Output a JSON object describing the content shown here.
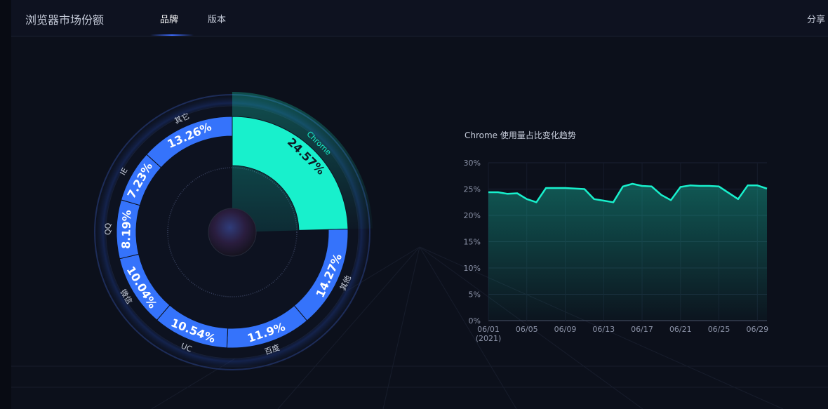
{
  "header": {
    "title": "浏览器市场份额",
    "tabs": [
      {
        "label": "品牌",
        "active": true
      },
      {
        "label": "版本",
        "active": false
      }
    ],
    "share_label": "分享"
  },
  "colors": {
    "accent": "#18f0cc",
    "segment": "#3573fb",
    "background": "#0c101b"
  },
  "chart_data": [
    {
      "type": "pie",
      "categories": [
        "Chrome",
        "其他",
        "百度",
        "UC",
        "微信",
        "QQ",
        "IE",
        "其它"
      ],
      "values": [
        24.57,
        14.27,
        11.9,
        10.54,
        10.04,
        8.19,
        7.23,
        13.26
      ],
      "labels": [
        "24.57%",
        "14.27%",
        "11.9%",
        "10.54%",
        "10.04%",
        "8.19%",
        "7.23%",
        "13.26%"
      ],
      "highlighted": "Chrome"
    },
    {
      "type": "area",
      "title": "Chrome 使用量占比变化趋势",
      "x_ticks": [
        "06/01",
        "06/05",
        "06/09",
        "06/13",
        "06/17",
        "06/21",
        "06/25",
        "06/29"
      ],
      "x_sub_label": "(2021)",
      "y_ticks": [
        "0%",
        "5%",
        "10%",
        "15%",
        "20%",
        "25%",
        "30%"
      ],
      "ylim": [
        0,
        30
      ],
      "x": [
        "06/01",
        "06/02",
        "06/03",
        "06/04",
        "06/05",
        "06/06",
        "06/07",
        "06/08",
        "06/09",
        "06/10",
        "06/11",
        "06/12",
        "06/13",
        "06/14",
        "06/15",
        "06/16",
        "06/17",
        "06/18",
        "06/19",
        "06/20",
        "06/21",
        "06/22",
        "06/23",
        "06/24",
        "06/25",
        "06/26",
        "06/27",
        "06/28",
        "06/29",
        "06/30"
      ],
      "values": [
        24.4,
        24.4,
        24.1,
        24.2,
        23.1,
        22.5,
        25.2,
        25.2,
        25.2,
        25.1,
        25.0,
        23.1,
        22.8,
        22.5,
        25.5,
        26.0,
        25.6,
        25.5,
        23.9,
        22.9,
        25.4,
        25.7,
        25.6,
        25.6,
        25.5,
        24.3,
        23.1,
        25.7,
        25.7,
        25.1
      ]
    }
  ]
}
